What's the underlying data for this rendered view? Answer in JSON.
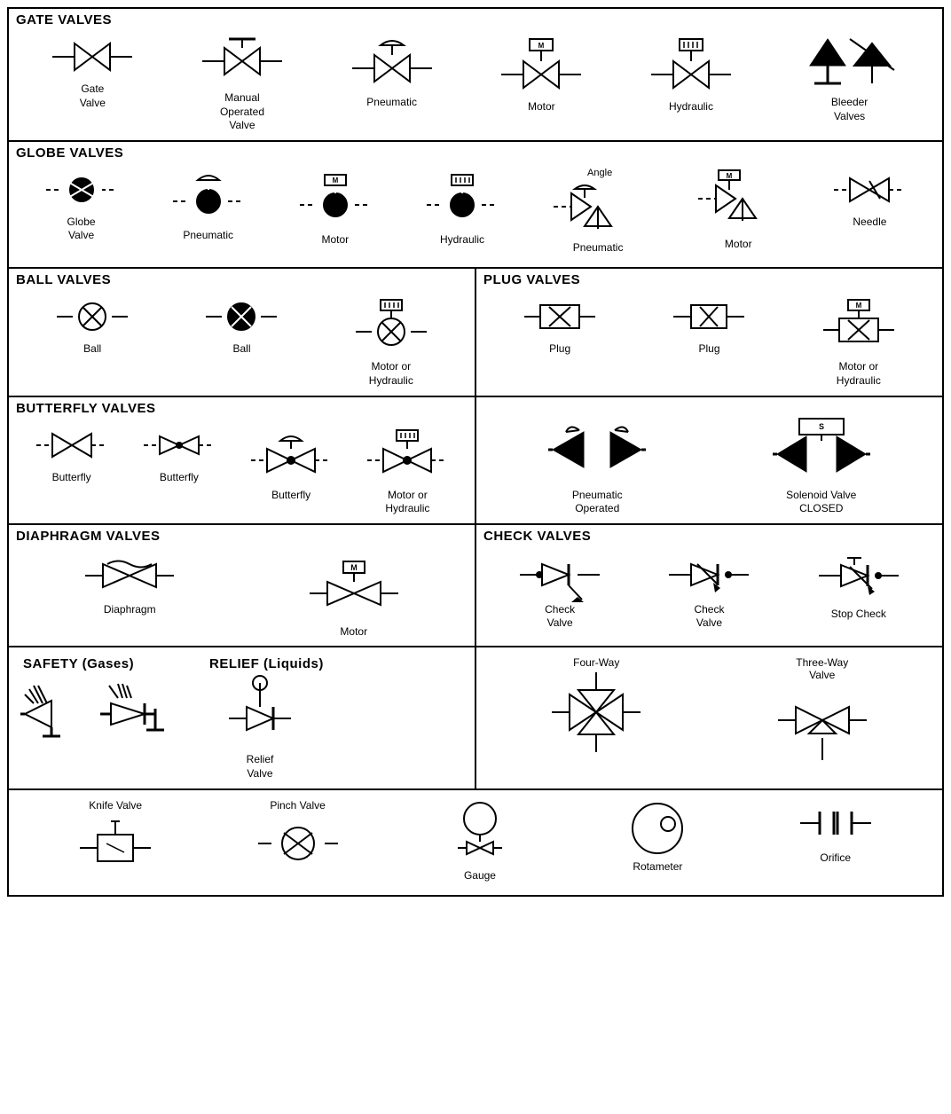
{
  "sections": {
    "gate_valves": {
      "title": "GATE VALVES",
      "items": [
        {
          "label": "Gate\nValve"
        },
        {
          "label": "Manual\nOperated\nValve"
        },
        {
          "label": "Pneumatic"
        },
        {
          "label": "Motor"
        },
        {
          "label": "Hydraulic"
        },
        {
          "label": "Bleeder\nValves"
        }
      ]
    },
    "globe_valves": {
      "title": "GLOBE VALVES",
      "items": [
        {
          "label": "Globe\nValve"
        },
        {
          "label": "Pneumatic"
        },
        {
          "label": "Motor"
        },
        {
          "label": "Hydraulic"
        },
        {
          "label": "Angle\nPneumatic"
        },
        {
          "label": "Motor"
        },
        {
          "label": "Needle"
        }
      ]
    },
    "ball_valves": {
      "title": "BALL VALVES",
      "items": [
        {
          "label": "Ball"
        },
        {
          "label": "Ball"
        },
        {
          "label": "Motor or\nHydraulic"
        }
      ]
    },
    "plug_valves": {
      "title": "PLUG VALVES",
      "items": [
        {
          "label": "Plug"
        },
        {
          "label": "Plug"
        },
        {
          "label": "Motor or\nHydraulic"
        }
      ]
    },
    "butterfly_valves": {
      "title": "BUTTERFLY VALVES",
      "items": [
        {
          "label": "Butterfly"
        },
        {
          "label": "Butterfly"
        },
        {
          "label": "Butterfly"
        },
        {
          "label": "Motor or\nHydraulic"
        }
      ]
    },
    "special_valves": {
      "items": [
        {
          "label": "Pneumatic\nOperated"
        },
        {
          "label": "Solenoid Valve\nCLOSED"
        }
      ]
    },
    "diaphragm_valves": {
      "title": "DIAPHRAGM VALVES",
      "items": [
        {
          "label": "Diaphragm"
        },
        {
          "label": "Motor"
        }
      ]
    },
    "check_valves": {
      "title": "CHECK VALVES",
      "items": [
        {
          "label": "Check\nValve"
        },
        {
          "label": "Check\nValve"
        },
        {
          "label": "Stop Check"
        }
      ]
    },
    "safety": {
      "title": "SAFETY (Gases)",
      "items": []
    },
    "relief": {
      "title": "RELIEF (Liquids)",
      "items": [
        {
          "label": "Relief\nValve"
        }
      ]
    },
    "four_way": {
      "items": [
        {
          "label": "Four-Way"
        },
        {
          "label": "Three-Way\nValve"
        }
      ]
    },
    "bottom": {
      "items": [
        {
          "label": "Knife Valve"
        },
        {
          "label": "Pinch Valve"
        },
        {
          "label": "Gauge"
        },
        {
          "label": "Rotameter"
        },
        {
          "label": "Orifice"
        }
      ]
    }
  }
}
